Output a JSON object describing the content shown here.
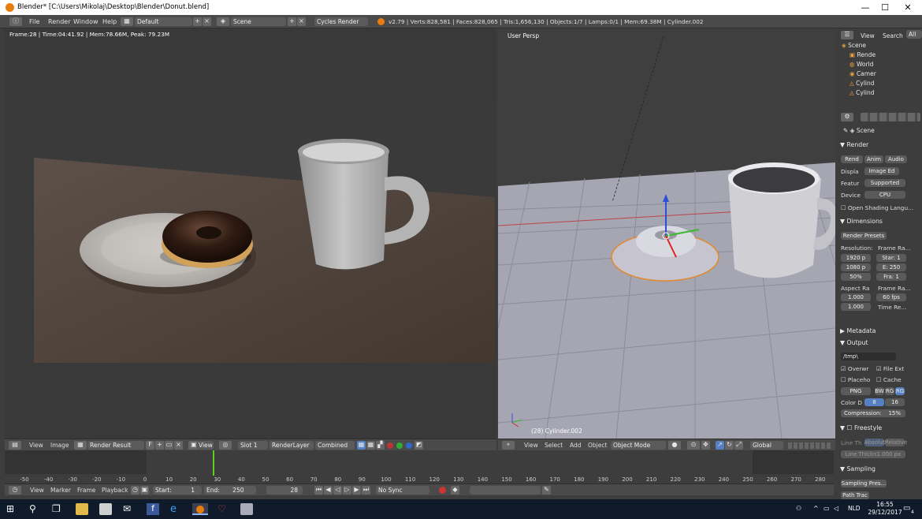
{
  "window": {
    "title": "Blender* [C:\\Users\\Mikolaj\\Desktop\\Blender\\Donut.blend]",
    "minimize": "—",
    "maximize": "☐",
    "close": "✕"
  },
  "top_menu": {
    "file": "File",
    "render": "Render",
    "window": "Window",
    "help": "Help",
    "layout": "Default",
    "scene": "Scene",
    "engine": "Cycles Render",
    "stats": "v2.79 | Verts:828,581 | Faces:828,065 | Tris:1,656,130 | Objects:1/7 | Lamps:0/1 | Mem:69.38M | Cylinder.002"
  },
  "image_editor": {
    "frame_info": "Frame:28 | Time:04:41.92 | Mem:78.66M, Peak: 79.23M",
    "header": {
      "view": "View",
      "image": "Image",
      "image_name": "Render Result",
      "f_label": "F",
      "view2": "View",
      "slot": "Slot 1",
      "layer": "RenderLayer",
      "pass": "Combined"
    }
  },
  "viewport": {
    "label": "User Persp",
    "object_label": "(28) Cylinder.002",
    "header": {
      "view": "View",
      "select": "Select",
      "add": "Add",
      "object": "Object",
      "mode": "Object Mode",
      "orientation": "Global"
    }
  },
  "timeline": {
    "ticks": [
      "-50",
      "-40",
      "-30",
      "-20",
      "-10",
      "0",
      "10",
      "20",
      "30",
      "40",
      "50",
      "60",
      "70",
      "80",
      "90",
      "100",
      "110",
      "120",
      "130",
      "140",
      "150",
      "160",
      "170",
      "180",
      "190",
      "200",
      "210",
      "220",
      "230",
      "240",
      "250",
      "260",
      "270",
      "280"
    ],
    "current_frame": 28,
    "frame_end": 250,
    "header": {
      "view": "View",
      "marker": "Marker",
      "frame": "Frame",
      "playback": "Playback",
      "start_label": "Start:",
      "start": "1",
      "end_label": "End:",
      "end": "250",
      "current": "28",
      "sync": "No Sync"
    }
  },
  "outliner": {
    "view": "View",
    "search": "Search",
    "all": "All",
    "items": [
      "Scene",
      "Rende",
      "World",
      "Camer",
      "Cylind",
      "Cylind"
    ]
  },
  "properties": {
    "scene": "Scene",
    "render_panel": "Render",
    "render_btn": "Rend",
    "anim_btn": "Anim",
    "audio_btn": "Audio",
    "display_label": "Displa",
    "display_value": "Image Ed",
    "feature_label": "Featur",
    "feature_value": "Supported",
    "device_label": "Device",
    "device_value": "CPU",
    "osl": "Open Shading Langu...",
    "dimensions_panel": "Dimensions",
    "presets": "Render Presets",
    "resolution_label": "Resolution:",
    "frame_range_label": "Frame Ra...",
    "res_x": "1920 p",
    "res_y": "1080 p",
    "res_pct": "50%",
    "start": "Star: 1",
    "end": "E: 250",
    "step": "Fra: 1",
    "aspect_label": "Aspect Ra",
    "frame_rate_label": "Frame Ra...",
    "aspect_x": "1.000",
    "aspect_y": "1.000",
    "fps": "60 fps",
    "time_remap": "Time Re...",
    "metadata_panel": "Metadata",
    "output_panel": "Output",
    "output_path": "/tmp\\",
    "overwrite": "Overwr",
    "file_ext": "File Ext",
    "placeholders": "Placeho",
    "cache": "Cache",
    "format": "PNG",
    "bw": "BW",
    "rgb": "RG",
    "rgba": "RG",
    "color_depth_label": "Color D",
    "depth_8": "8",
    "depth_16": "16",
    "compression": "Compression:",
    "compression_value": "15%",
    "freestyle_panel": "Freestyle",
    "line_thickness_mode": "Line Th",
    "absolute": "Absolut",
    "relative": "Relative",
    "line_thickness": "Line Thickn1.000 px",
    "sampling_panel": "Sampling",
    "sampling_presets": "Sampling Pres...",
    "path_tracing": "Path Trac"
  },
  "taskbar": {
    "time": "16:55",
    "date": "29/12/2017",
    "lang": "NLD",
    "notif_count": "4"
  },
  "colors": {
    "accent": "#5680c2",
    "blender_orange": "#e87d0d",
    "frame_line": "#5ad21c"
  }
}
